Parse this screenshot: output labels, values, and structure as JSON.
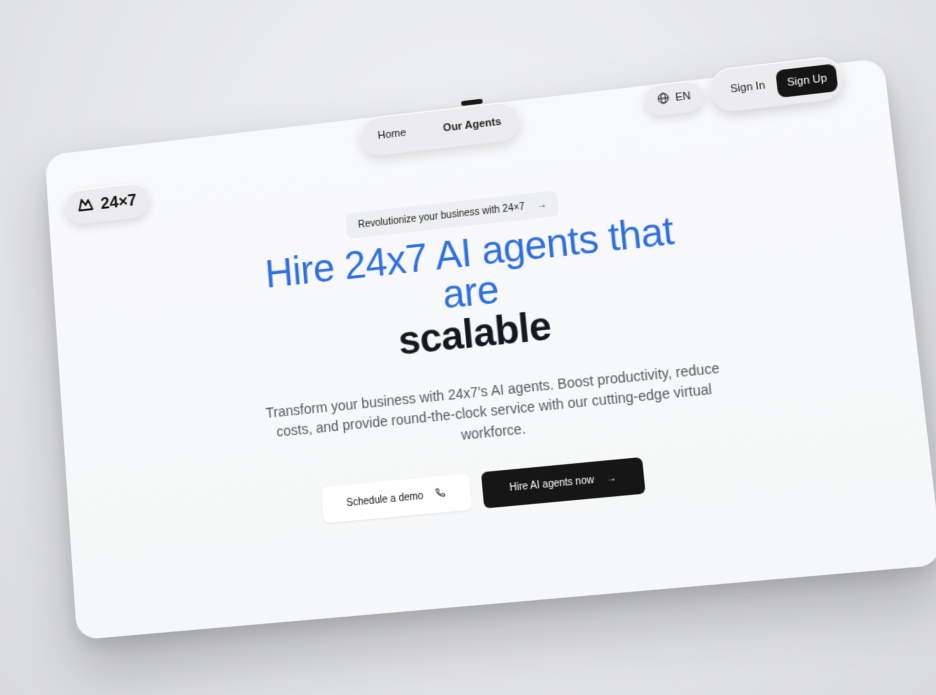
{
  "logo": {
    "text": "24×7",
    "icon": "mountain-logo-icon"
  },
  "nav": {
    "items": [
      {
        "label": "Home"
      },
      {
        "label": "Our Agents"
      }
    ],
    "active": 1
  },
  "lang": {
    "label": "EN",
    "icon": "globe-icon"
  },
  "auth": {
    "sign_in": "Sign In",
    "sign_up": "Sign Up"
  },
  "announce": {
    "text": "Revolutionize your business with 24×7",
    "arrow": "→"
  },
  "hero": {
    "line1": "Hire 24x7 AI agents that",
    "line2": "are",
    "line3": "scalable",
    "subtitle": "Transform your business with 24x7's AI agents. Boost productivity, reduce costs, and provide round-the-clock service with our cutting-edge virtual workforce."
  },
  "cta": {
    "demo_label": "Schedule a demo",
    "demo_icon": "phone-icon",
    "hire_label": "Hire AI agents now",
    "hire_arrow": "→"
  },
  "colors": {
    "accent_blue": "#2f6fde",
    "dark": "#141722",
    "button_dark": "#161616"
  }
}
